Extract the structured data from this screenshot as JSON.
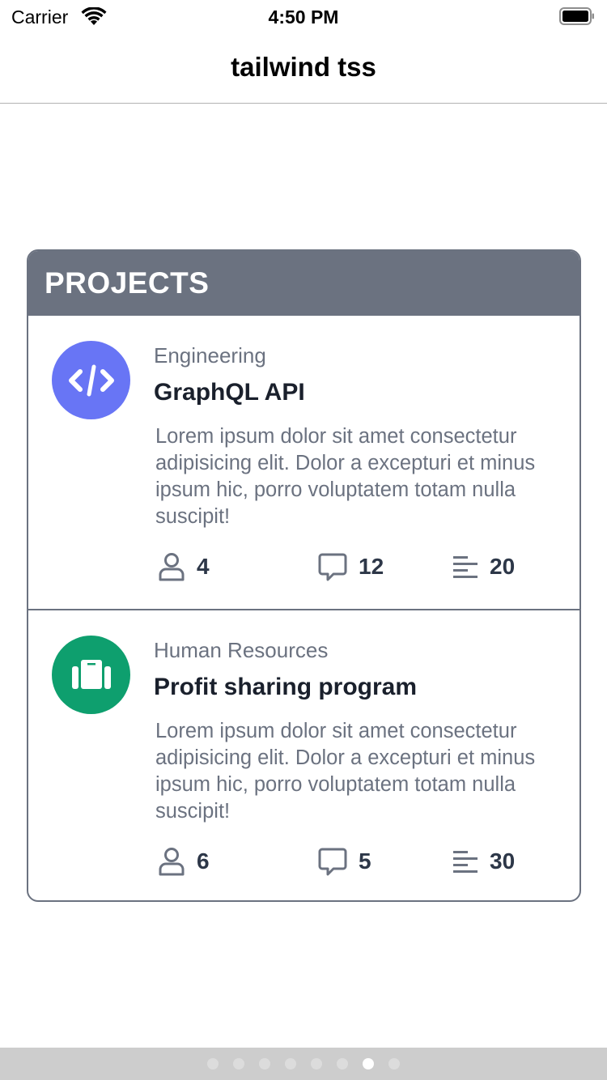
{
  "status_bar": {
    "carrier": "Carrier",
    "time": "4:50 PM",
    "icons": [
      "wifi-icon",
      "battery-icon"
    ]
  },
  "navbar": {
    "title": "tailwind tss"
  },
  "card": {
    "header": "PROJECTS",
    "projects": [
      {
        "category": "Engineering",
        "title": "GraphQL API",
        "description": "Lorem ipsum dolor sit amet consectetur adipisicing elit. Dolor a excepturi et minus ipsum hic, porro voluptatem totam nulla suscipit!",
        "icon": "code-icon",
        "icon_color": "#6875f5",
        "stats": {
          "members": "4",
          "comments": "12",
          "tasks": "20"
        }
      },
      {
        "category": "Human Resources",
        "title": "Profit sharing program",
        "description": "Lorem ipsum dolor sit amet consectetur adipisicing elit. Dolor a excepturi et minus ipsum hic, porro voluptatem totam nulla suscipit!",
        "icon": "briefcase-icon",
        "icon_color": "#0e9f6e",
        "stats": {
          "members": "6",
          "comments": "5",
          "tasks": "30"
        }
      }
    ]
  },
  "page_control": {
    "total_pages": 8,
    "current_page": 7
  },
  "colors": {
    "header_bg": "#6b7280",
    "card_border": "#6b7280",
    "text_muted": "#6b7280",
    "text_dark": "#1a202c",
    "engineering_accent": "#6875f5",
    "hr_accent": "#0e9f6e"
  }
}
